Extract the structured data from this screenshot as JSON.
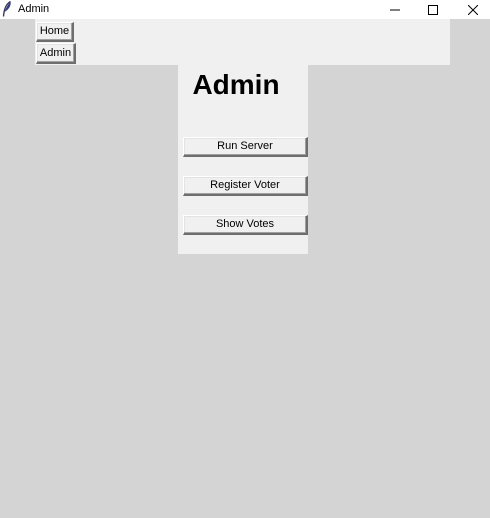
{
  "window": {
    "title": "Admin"
  },
  "nav": {
    "home_label": "Home",
    "admin_label": "Admin"
  },
  "page": {
    "heading": "Admin"
  },
  "actions": {
    "run_server": "Run Server",
    "register_voter": "Register Voter",
    "show_votes": "Show Votes"
  },
  "icons": {
    "app": "feather-icon",
    "minimize": "minimize-icon",
    "maximize": "maximize-icon",
    "close": "close-icon"
  },
  "colors": {
    "desktop_background": "#d4d4d4",
    "panel_background": "#f0f0f0",
    "titlebar_background": "#ffffff"
  }
}
